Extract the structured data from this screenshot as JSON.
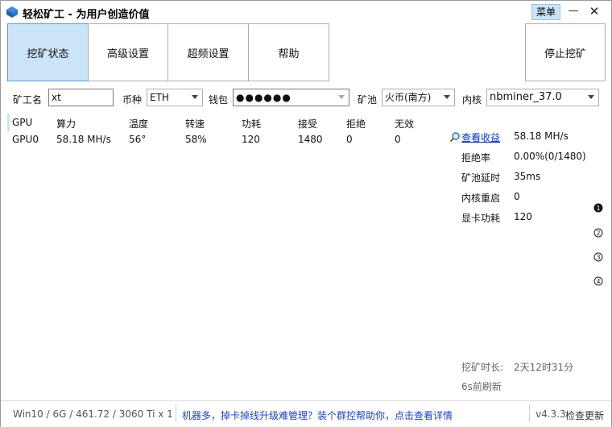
{
  "window": {
    "title": "轻松矿工 - 为用户创造价值",
    "menu_label": "菜单",
    "minimize_glyph": "—",
    "close_glyph": "✕"
  },
  "tabs": [
    {
      "label": "挖矿状态",
      "active": true
    },
    {
      "label": "高级设置",
      "active": false
    },
    {
      "label": "超频设置",
      "active": false
    },
    {
      "label": "帮助",
      "active": false
    }
  ],
  "stop_button_label": "停止挖矿",
  "config": {
    "miner_name_label": "矿工名",
    "miner_name_value": "xt",
    "coin_label": "币种",
    "coin_value": "ETH",
    "wallet_label": "钱包",
    "wallet_value": "●●●●●●",
    "pool_label": "矿池",
    "pool_value": "火币(南方)",
    "kernel_label": "内核",
    "kernel_value": "nbminer_37.0"
  },
  "gpu_table": {
    "headers": [
      "GPU",
      "算力",
      "温度",
      "转速",
      "功耗",
      "接受",
      "拒绝",
      "无效"
    ],
    "rows": [
      [
        "GPU0",
        "58.18 MH/s",
        "56°",
        "58%",
        "120",
        "1480",
        "0",
        "0"
      ]
    ]
  },
  "stats": {
    "view_earnings_label": "查看收益",
    "hashrate_value": "58.18 MH/s",
    "reject_rate_label": "拒绝率",
    "reject_rate_value": "0.00%(0/1480)",
    "pool_latency_label": "矿池延时",
    "pool_latency_value": "35ms",
    "kernel_restart_label": "内核重启",
    "kernel_restart_value": "0",
    "gpu_power_label": "显卡功耗",
    "gpu_power_value": "120"
  },
  "pager": [
    "1",
    "2",
    "3",
    "4"
  ],
  "mining_time_label": "挖矿时长:",
  "mining_time_value": "2天12时31分",
  "refresh_text": "6s前刷新",
  "statusbar": {
    "system_info": "Win10  / 6G / 461.72 / 3060 Ti x 1",
    "promo_text": "机器多，掉卡掉线升级难管理？装个群控帮助你，点击查看详情",
    "version": "v4.3.3",
    "update_label": "检查更新"
  },
  "colors": {
    "accent_bg": "#cce4f7",
    "accent_border": "#5a9bd5",
    "link": "#0033cc",
    "promo": "#1a3fcc"
  }
}
